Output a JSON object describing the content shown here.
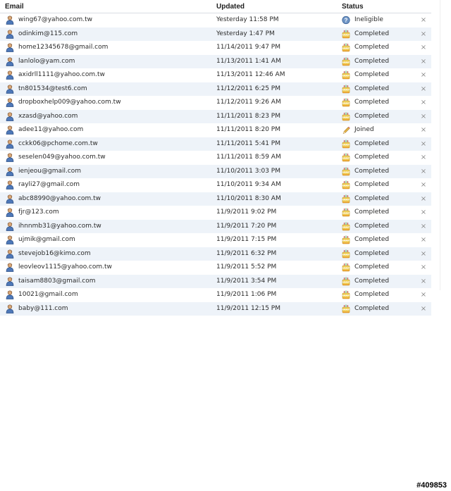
{
  "table": {
    "headers": {
      "email": "Email",
      "updated": "Updated",
      "status": "Status"
    },
    "rows": [
      {
        "email": "wing67@yahoo.com.tw",
        "updated": "Yesterday 11:58 PM",
        "status": "Ineligible",
        "status_icon": "ineligible-icon"
      },
      {
        "email": "odinkim@115.com",
        "updated": "Yesterday 1:47 PM",
        "status": "Completed",
        "status_icon": "completed-cake-icon"
      },
      {
        "email": "home12345678@gmail.com",
        "updated": "11/14/2011 9:47 PM",
        "status": "Completed",
        "status_icon": "completed-cake-icon"
      },
      {
        "email": "lanlolo@yam.com",
        "updated": "11/13/2011 1:41 AM",
        "status": "Completed",
        "status_icon": "completed-cake-icon"
      },
      {
        "email": "axidrll1111@yahoo.com.tw",
        "updated": "11/13/2011 12:46 AM",
        "status": "Completed",
        "status_icon": "completed-cake-icon"
      },
      {
        "email": "tn801534@test6.com",
        "updated": "11/12/2011 6:25 PM",
        "status": "Completed",
        "status_icon": "completed-cake-icon"
      },
      {
        "email": "dropboxhelp009@yahoo.com.tw",
        "updated": "11/12/2011 9:26 AM",
        "status": "Completed",
        "status_icon": "completed-cake-icon"
      },
      {
        "email": "xzasd@yahoo.com",
        "updated": "11/11/2011 8:23 PM",
        "status": "Completed",
        "status_icon": "completed-cake-icon"
      },
      {
        "email": "adee11@yahoo.com",
        "updated": "11/11/2011 8:20 PM",
        "status": "Joined",
        "status_icon": "joined-pencil-icon"
      },
      {
        "email": "cckk06@pchome.com.tw",
        "updated": "11/11/2011 5:41 PM",
        "status": "Completed",
        "status_icon": "completed-cake-icon"
      },
      {
        "email": "seselen049@yahoo.com.tw",
        "updated": "11/11/2011 8:59 AM",
        "status": "Completed",
        "status_icon": "completed-cake-icon"
      },
      {
        "email": "ienjeou@gmail.com",
        "updated": "11/10/2011 3:03 PM",
        "status": "Completed",
        "status_icon": "completed-cake-icon"
      },
      {
        "email": "rayli27@gmail.com",
        "updated": "11/10/2011 9:34 AM",
        "status": "Completed",
        "status_icon": "completed-cake-icon"
      },
      {
        "email": "abc88990@yahoo.com.tw",
        "updated": "11/10/2011 8:30 AM",
        "status": "Completed",
        "status_icon": "completed-cake-icon"
      },
      {
        "email": "fjr@123.com",
        "updated": "11/9/2011 9:02 PM",
        "status": "Completed",
        "status_icon": "completed-cake-icon"
      },
      {
        "email": "ihnnmb31@yahoo.com.tw",
        "updated": "11/9/2011 7:20 PM",
        "status": "Completed",
        "status_icon": "completed-cake-icon"
      },
      {
        "email": "ujmik@gmail.com",
        "updated": "11/9/2011 7:15 PM",
        "status": "Completed",
        "status_icon": "completed-cake-icon"
      },
      {
        "email": "stevejob16@kimo.com",
        "updated": "11/9/2011 6:32 PM",
        "status": "Completed",
        "status_icon": "completed-cake-icon"
      },
      {
        "email": "leovleov1115@yahoo.com.tw",
        "updated": "11/9/2011 5:52 PM",
        "status": "Completed",
        "status_icon": "completed-cake-icon"
      },
      {
        "email": "taisam8803@gmail.com",
        "updated": "11/9/2011 3:54 PM",
        "status": "Completed",
        "status_icon": "completed-cake-icon"
      },
      {
        "email": "10021@gmail.com",
        "updated": "11/9/2011 1:06 PM",
        "status": "Completed",
        "status_icon": "completed-cake-icon"
      },
      {
        "email": "baby@111.com",
        "updated": "11/9/2011 12:15 PM",
        "status": "Completed",
        "status_icon": "completed-cake-icon"
      }
    ],
    "remove_glyph": "×",
    "row_icon": "user-icon"
  },
  "watermark": "#409853",
  "colors": {
    "row_alt_bg": "#eef3f9",
    "header_border": "#d9dde3",
    "remove_color": "#8c8c8c"
  }
}
